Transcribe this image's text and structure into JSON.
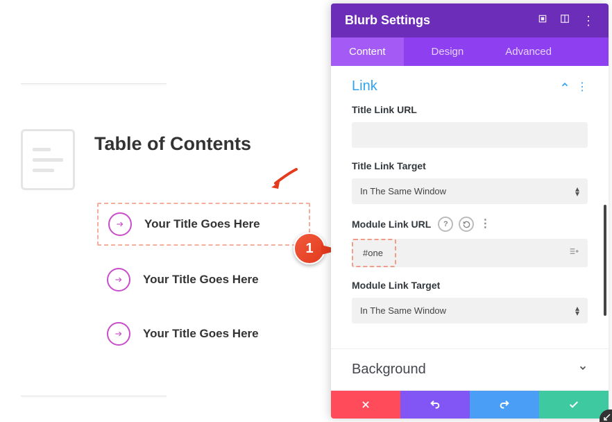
{
  "page": {
    "toc_title": "Table of Contents",
    "items": [
      {
        "label": "Your Title Goes Here"
      },
      {
        "label": "Your Title Goes Here"
      },
      {
        "label": "Your Title Goes Here"
      }
    ]
  },
  "callout": {
    "number": "1"
  },
  "panel": {
    "title": "Blurb Settings",
    "tabs": [
      {
        "label": "Content",
        "active": true
      },
      {
        "label": "Design",
        "active": false
      },
      {
        "label": "Advanced",
        "active": false
      }
    ],
    "sections": {
      "link": {
        "title": "Link",
        "title_link_url": {
          "label": "Title Link URL",
          "value": ""
        },
        "title_link_target": {
          "label": "Title Link Target",
          "value": "In The Same Window"
        },
        "module_link_url": {
          "label": "Module Link URL",
          "value": "#one"
        },
        "module_link_target": {
          "label": "Module Link Target",
          "value": "In The Same Window"
        }
      },
      "background": {
        "title": "Background"
      }
    },
    "footer": {
      "cancel": "cancel",
      "undo": "undo",
      "redo": "redo",
      "save": "save"
    }
  },
  "icons": {
    "help": "?",
    "reset": "reset",
    "more": "⋮"
  },
  "colors": {
    "accent_purple": "#8e3ff0",
    "header_purple": "#6c2eb9",
    "link_blue": "#2ea3f2",
    "pink": "#c94dc9",
    "callout_red": "#e43a1e"
  }
}
